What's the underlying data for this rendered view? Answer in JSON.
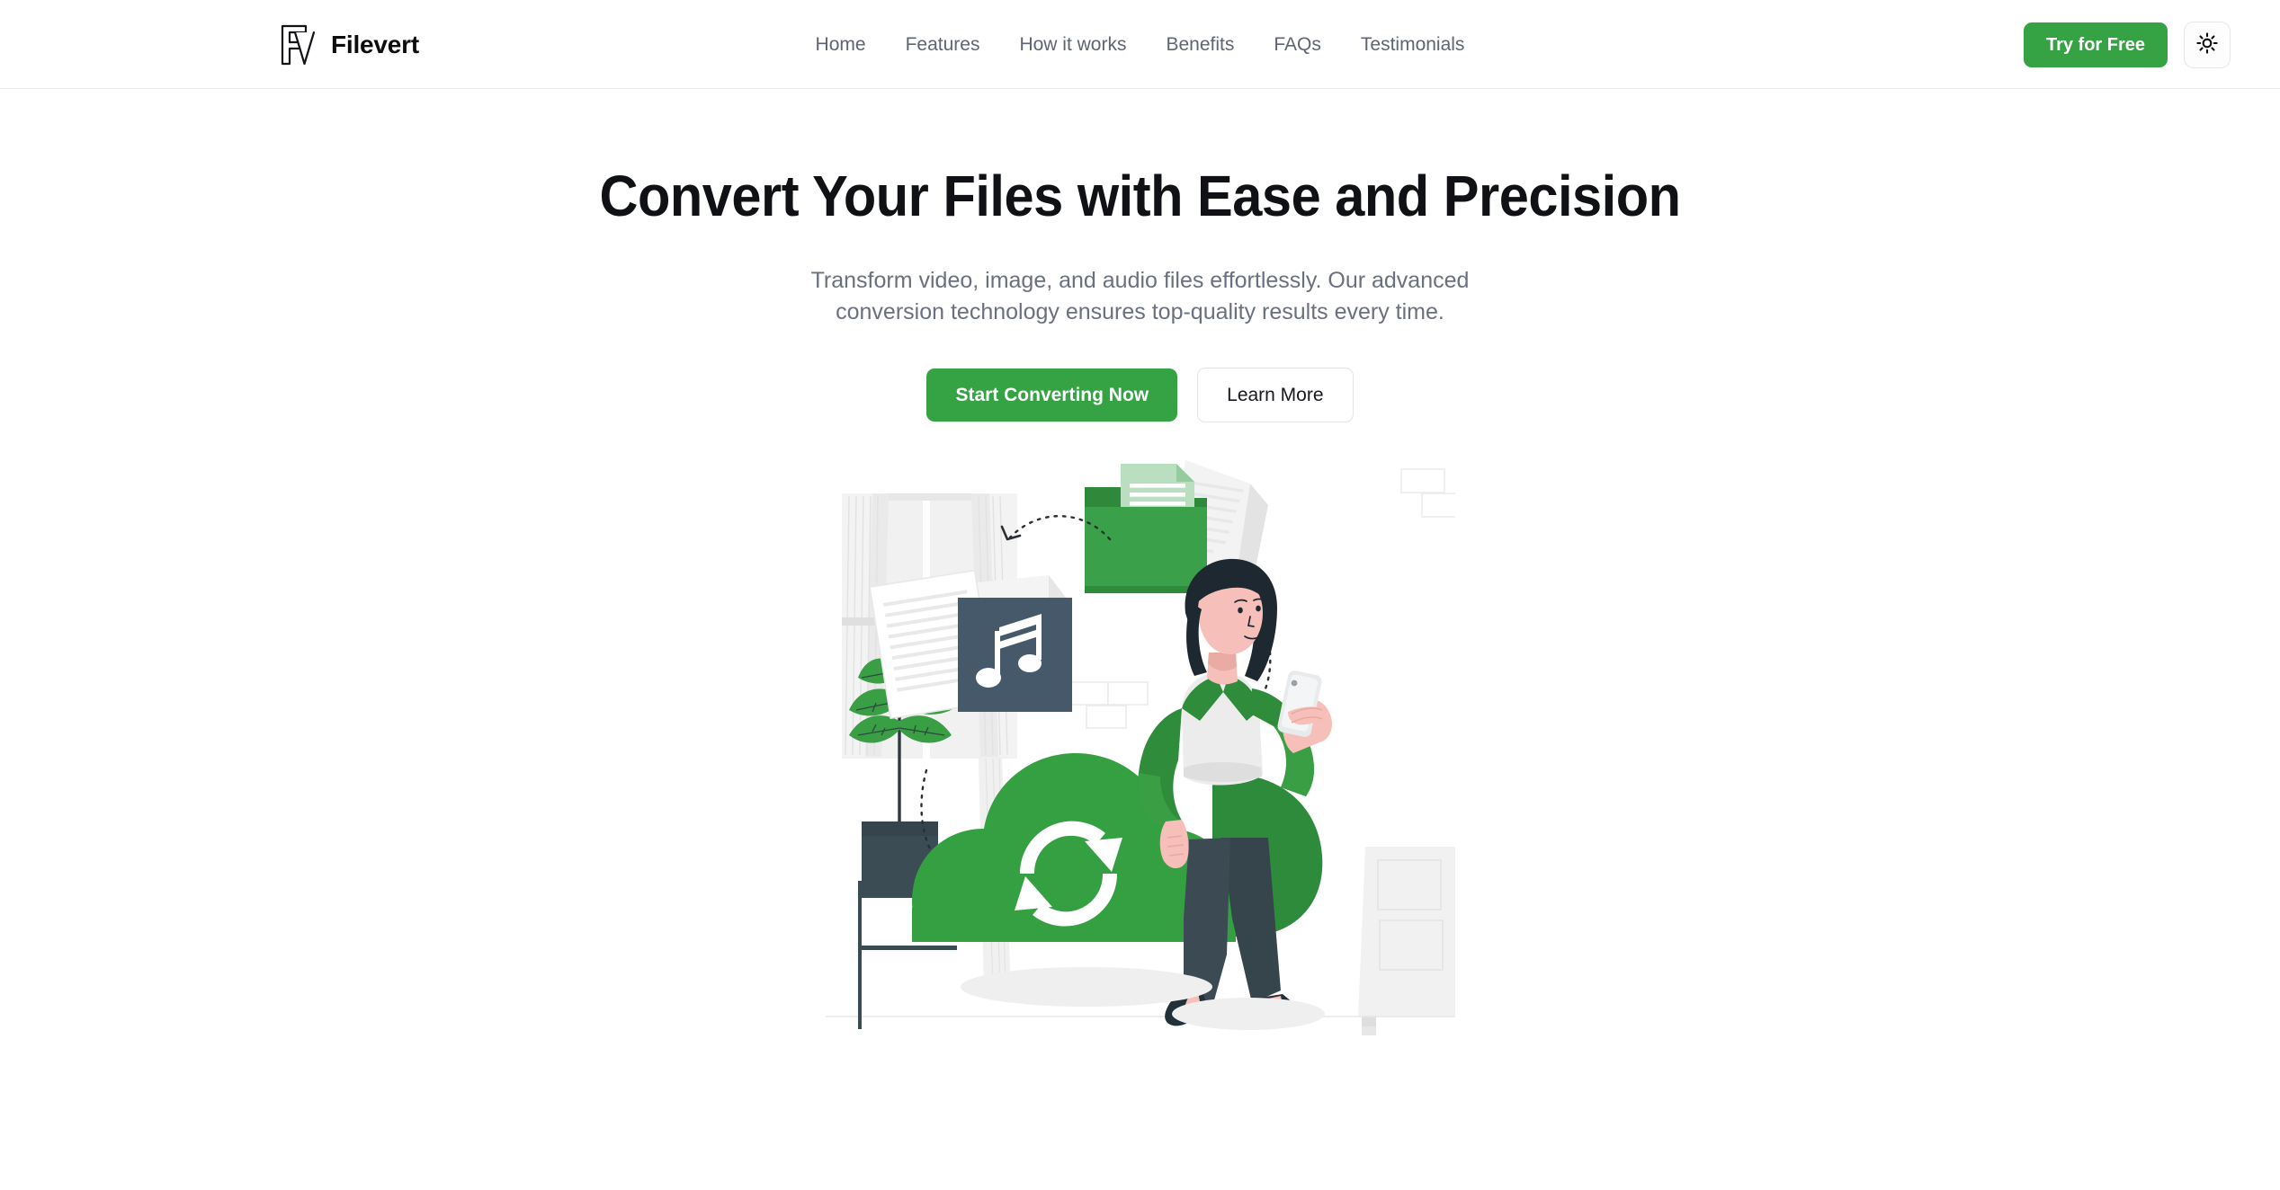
{
  "brand": {
    "name": "Filevert",
    "logo_icon": "fv-monogram-icon"
  },
  "header": {
    "nav": [
      {
        "label": "Home",
        "name": "nav-link-home"
      },
      {
        "label": "Features",
        "name": "nav-link-features"
      },
      {
        "label": "How it works",
        "name": "nav-link-how-it-works"
      },
      {
        "label": "Benefits",
        "name": "nav-link-benefits"
      },
      {
        "label": "FAQs",
        "name": "nav-link-faqs"
      },
      {
        "label": "Testimonials",
        "name": "nav-link-testimonials"
      }
    ],
    "try_free_label": "Try for Free",
    "theme_toggle_icon": "sun-icon"
  },
  "hero": {
    "title": "Convert Your Files with Ease and Precision",
    "subtitle": "Transform video, image, and audio files effortlessly. Our advanced conversion technology ensures top-quality results every time.",
    "primary_cta": "Start Converting Now",
    "secondary_cta": "Learn More",
    "illustration_alt": "file-conversion-illustration"
  },
  "colors": {
    "brand_green": "#35a244",
    "folder_green": "#3aa049",
    "cloud_green": "#34a041",
    "dark_slate": "#46596a",
    "text_primary": "#101114",
    "text_muted": "#6a7080",
    "border": "#e6e6ea"
  }
}
